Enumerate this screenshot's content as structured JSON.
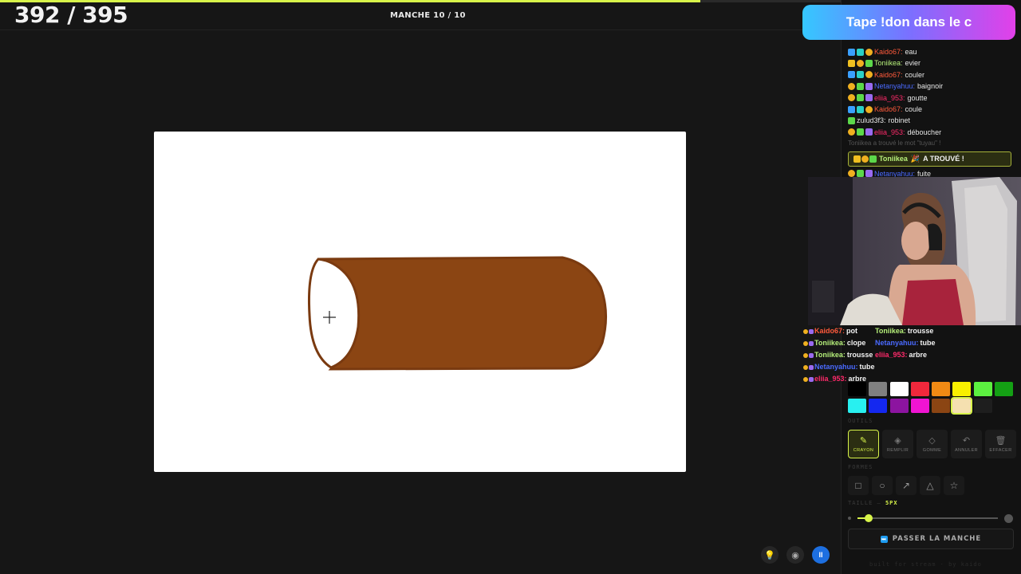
{
  "game": {
    "score": "392 / 395",
    "round": "MANCHE 10 / 10",
    "timer_progress": 0.833
  },
  "banner": {
    "text": "Tape !don dans le c"
  },
  "chat": [
    {
      "badges": [
        "sword",
        "yt",
        "coin"
      ],
      "user": "Kaido67:",
      "user_color": "#ff5a3c",
      "text": "eau"
    },
    {
      "badges": [
        "crown",
        "coin",
        "plus"
      ],
      "user": "Toniikea:",
      "user_color": "#b6f07a",
      "text": "evier"
    },
    {
      "badges": [
        "sword",
        "yt",
        "coin"
      ],
      "user": "Kaido67:",
      "user_color": "#ff5a3c",
      "text": "couler"
    },
    {
      "badges": [
        "coin",
        "plus",
        "gem"
      ],
      "user": "Netanyahuu:",
      "user_color": "#4a6aff",
      "text": "baignoir"
    },
    {
      "badges": [
        "coin",
        "plus",
        "gem"
      ],
      "user": "eliia_953:",
      "user_color": "#ff2a6a",
      "text": "goutte"
    },
    {
      "badges": [
        "sword",
        "yt",
        "coin"
      ],
      "user": "Kaido67:",
      "user_color": "#ff5a3c",
      "text": "coule"
    },
    {
      "badges": [
        "plus"
      ],
      "user": "zulud3f3:",
      "user_color": "#e6e6e6",
      "text": "robinet"
    },
    {
      "badges": [
        "coin",
        "plus",
        "gem"
      ],
      "user": "eliia_953:",
      "user_color": "#ff2a6a",
      "text": "déboucher"
    }
  ],
  "system_message": "Toniikea a trouvé le mot \"tuyau\" !",
  "found_banner": {
    "user": "Toniikea",
    "text": "A TROUVÉ !"
  },
  "chat_after": {
    "user": "Netanyahuu:",
    "user_color": "#4a6aff",
    "text": "fuite"
  },
  "overlay_left": [
    {
      "user": "Kaido67:",
      "user_color": "#ff5a3c",
      "text": "pot"
    },
    {
      "user": "Toniikea:",
      "user_color": "#b6f07a",
      "text": "clope"
    },
    {
      "user": "Toniikea:",
      "user_color": "#b6f07a",
      "text": "trousse"
    },
    {
      "user": "Netanyahuu:",
      "user_color": "#4a6aff",
      "text": "tube"
    },
    {
      "user": "eliia_953:",
      "user_color": "#ff2a6a",
      "text": "arbre"
    }
  ],
  "overlay_right": [
    {
      "user": "Toniikea:",
      "user_color": "#b6f07a",
      "text": "trousse"
    },
    {
      "user": "Netanyahuu:",
      "user_color": "#4a6aff",
      "text": "tube"
    },
    {
      "user": "eliia_953:",
      "user_color": "#ff2a6a",
      "text": "arbre"
    }
  ],
  "palette": {
    "colors": [
      "#000000",
      "#808080",
      "#ffffff",
      "#f0283c",
      "#f08a14",
      "#f8f000",
      "#5cf040",
      "#14a014",
      "#28f0f0",
      "#1428f0",
      "#8c14a0",
      "#f014d2",
      "#8b4513",
      "#f5e0b0",
      "#1e1e1e"
    ],
    "selected_index": 13
  },
  "labels": {
    "tools": "OUTILS",
    "shapes": "FORMES",
    "size": "TAILLE —",
    "size_value": "5PX"
  },
  "tools": [
    {
      "id": "pencil",
      "icon": "✎",
      "label": "CRAYON",
      "active": true
    },
    {
      "id": "fill",
      "icon": "◈",
      "label": "REMPLIR",
      "active": false
    },
    {
      "id": "eraser",
      "icon": "◇",
      "label": "GOMME",
      "active": false
    },
    {
      "id": "undo",
      "icon": "↶",
      "label": "ANNULER",
      "active": false
    },
    {
      "id": "clear",
      "icon": "🗑",
      "label": "EFFACER",
      "active": false
    }
  ],
  "shapes": [
    {
      "id": "rectangle",
      "icon": "□"
    },
    {
      "id": "ellipse",
      "icon": "○"
    },
    {
      "id": "arrow",
      "icon": "↗"
    },
    {
      "id": "triangle",
      "icon": "△"
    },
    {
      "id": "star",
      "icon": "☆"
    }
  ],
  "brush_size": {
    "value": 5,
    "min": 1,
    "max": 50
  },
  "skip_button": {
    "label": "PASSER LA MANCHE"
  },
  "footer": {
    "text": "built for stream · by kaido"
  },
  "drawing": {
    "fill": "#8b4513",
    "stroke": "#7a3a10"
  }
}
